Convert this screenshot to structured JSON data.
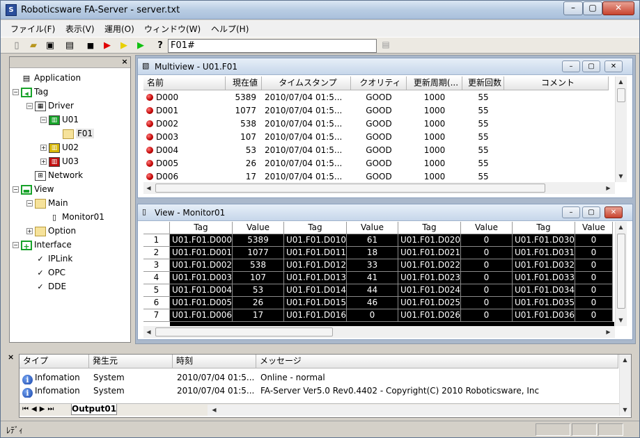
{
  "window": {
    "title": "Roboticsware FA-Server - server.txt",
    "icon_letter": "S"
  },
  "menu": [
    "ファイル(F)",
    "表示(V)",
    "運用(O)",
    "ウィンドウ(W)",
    "ヘルプ(H)"
  ],
  "toolbar": {
    "address_value": "F01#",
    "icons": [
      "new-file-icon",
      "open-folder-icon",
      "save-icon",
      "properties-icon",
      "stop-icon",
      "play-red-icon",
      "play-yellow-icon",
      "play-green-icon",
      "help-icon"
    ]
  },
  "tree": {
    "close_glyph": "×",
    "nodes": [
      {
        "label": "Application",
        "level": 0,
        "icon": "application-icon",
        "expander": ""
      },
      {
        "label": "Tag",
        "level": 0,
        "icon": "tag-icon",
        "expander": "-"
      },
      {
        "label": "Driver",
        "level": 1,
        "icon": "driver-icon",
        "expander": "-"
      },
      {
        "label": "U01",
        "level": 2,
        "icon": "device-green-icon",
        "expander": "-"
      },
      {
        "label": "F01",
        "level": 3,
        "icon": "folder-open-icon",
        "expander": ""
      },
      {
        "label": "U02",
        "level": 2,
        "icon": "device-yellow-icon",
        "expander": "+"
      },
      {
        "label": "U03",
        "level": 2,
        "icon": "device-red-icon",
        "expander": "+"
      },
      {
        "label": "Network",
        "level": 1,
        "icon": "network-icon",
        "expander": ""
      },
      {
        "label": "View",
        "level": 0,
        "icon": "view-icon",
        "expander": "-"
      },
      {
        "label": "Main",
        "level": 1,
        "icon": "folder-icon",
        "expander": "-"
      },
      {
        "label": "Monitor01",
        "level": 2,
        "icon": "monitor-icon",
        "expander": ""
      },
      {
        "label": "Option",
        "level": 1,
        "icon": "folder-icon",
        "expander": "+"
      },
      {
        "label": "Interface",
        "level": 0,
        "icon": "interface-icon",
        "expander": "-"
      },
      {
        "label": "IPLink",
        "level": 1,
        "icon": "check-doc-icon",
        "expander": ""
      },
      {
        "label": "OPC",
        "level": 1,
        "icon": "check-doc-icon",
        "expander": ""
      },
      {
        "label": "DDE",
        "level": 1,
        "icon": "check-doc-icon",
        "expander": ""
      }
    ]
  },
  "multiview": {
    "title": "Multiview - U01.F01",
    "columns": [
      "名前",
      "現在値",
      "タイムスタンプ",
      "クオリティ",
      "更新周期(...",
      "更新回数",
      "コメント"
    ],
    "rows": [
      [
        "D000",
        "5389",
        "2010/07/04 01:5...",
        "GOOD",
        "1000",
        "55",
        ""
      ],
      [
        "D001",
        "1077",
        "2010/07/04 01:5...",
        "GOOD",
        "1000",
        "55",
        ""
      ],
      [
        "D002",
        "538",
        "2010/07/04 01:5...",
        "GOOD",
        "1000",
        "55",
        ""
      ],
      [
        "D003",
        "107",
        "2010/07/04 01:5...",
        "GOOD",
        "1000",
        "55",
        ""
      ],
      [
        "D004",
        "53",
        "2010/07/04 01:5...",
        "GOOD",
        "1000",
        "55",
        ""
      ],
      [
        "D005",
        "26",
        "2010/07/04 01:5...",
        "GOOD",
        "1000",
        "55",
        ""
      ],
      [
        "D006",
        "17",
        "2010/07/04 01:5...",
        "GOOD",
        "1000",
        "55",
        ""
      ]
    ]
  },
  "monitor": {
    "title": "View - Monitor01",
    "columns": [
      "Tag",
      "Value",
      "Tag",
      "Value",
      "Tag",
      "Value",
      "Tag",
      "Value"
    ],
    "rows": [
      {
        "n": "1",
        "cells": [
          "U01.F01.D000",
          "5389",
          "U01.F01.D010",
          "61",
          "U01.F01.D020",
          "0",
          "U01.F01.D030",
          "0"
        ]
      },
      {
        "n": "2",
        "cells": [
          "U01.F01.D001",
          "1077",
          "U01.F01.D011",
          "18",
          "U01.F01.D021",
          "0",
          "U01.F01.D031",
          "0"
        ]
      },
      {
        "n": "3",
        "cells": [
          "U01.F01.D002",
          "538",
          "U01.F01.D012",
          "33",
          "U01.F01.D022",
          "0",
          "U01.F01.D032",
          "0"
        ]
      },
      {
        "n": "4",
        "cells": [
          "U01.F01.D003",
          "107",
          "U01.F01.D013",
          "41",
          "U01.F01.D023",
          "0",
          "U01.F01.D033",
          "0"
        ]
      },
      {
        "n": "5",
        "cells": [
          "U01.F01.D004",
          "53",
          "U01.F01.D014",
          "44",
          "U01.F01.D024",
          "0",
          "U01.F01.D034",
          "0"
        ]
      },
      {
        "n": "6",
        "cells": [
          "U01.F01.D005",
          "26",
          "U01.F01.D015",
          "46",
          "U01.F01.D025",
          "0",
          "U01.F01.D035",
          "0"
        ]
      },
      {
        "n": "7",
        "cells": [
          "U01.F01.D006",
          "17",
          "U01.F01.D016",
          "0",
          "U01.F01.D026",
          "0",
          "U01.F01.D036",
          "0"
        ]
      }
    ]
  },
  "output": {
    "columns": [
      "タイプ",
      "発生元",
      "時刻",
      "メッセージ"
    ],
    "rows": [
      [
        "Infomation",
        "System",
        "2010/07/04 01:5...",
        "Online - normal"
      ],
      [
        "Infomation",
        "System",
        "2010/07/04 01:5...",
        "FA-Server Ver5.0 Rev0.4402 - Copyright(C) 2010 Roboticsware, Inc"
      ]
    ],
    "tab_label": "Output01",
    "close_glyph": "×"
  },
  "status": {
    "text": "ﾚﾃﾞｨ"
  }
}
